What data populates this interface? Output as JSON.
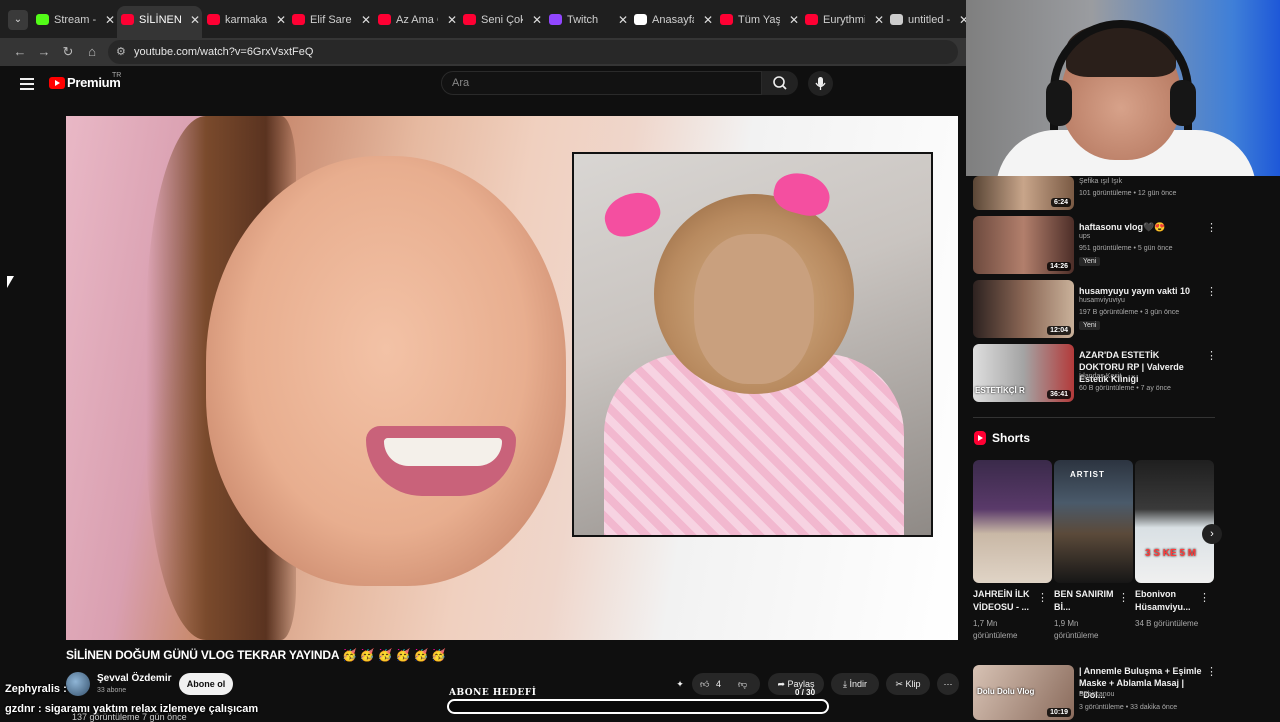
{
  "browser": {
    "tabs": [
      {
        "label": "Stream - K",
        "color": "#53fc18"
      },
      {
        "label": "SİLİNEN D",
        "color": "#ff0033",
        "active": true
      },
      {
        "label": "karmakarış",
        "color": "#ff0033"
      },
      {
        "label": "Elif Sare Al",
        "color": "#ff0033"
      },
      {
        "label": "Az Ama Öz",
        "color": "#ff0033"
      },
      {
        "label": "Seni Çok S",
        "color": "#ff0033"
      },
      {
        "label": "Twitch",
        "color": "#9146ff"
      },
      {
        "label": "Anasayfa /",
        "color": "#ffffff"
      },
      {
        "label": "Tüm Yaş K",
        "color": "#ff0033"
      },
      {
        "label": "Eurythmics",
        "color": "#ff0033"
      },
      {
        "label": "untitled - ",
        "color": "#cccccc"
      }
    ],
    "url": "youtube.com/watch?v=6GrxVsxtFeQ"
  },
  "header": {
    "logo": "Premium",
    "region": "TR",
    "search_placeholder": "Ara"
  },
  "video": {
    "title": "SİLİNEN DOĞUM GÜNÜ VLOG TEKRAR YAYINDA",
    "title_emojis": "🥳 🥳 🥳 🥳 🥳 🥳",
    "channel": "Şevval Özdemir",
    "subscribers": "33 abone",
    "subscribe_label": "Abone ol",
    "likes": "4",
    "share_label": "Paylaş",
    "download_label": "İndir",
    "clip_label": "Klip",
    "views_line": "137 görüntüleme  7 gün önce"
  },
  "sidebar": {
    "recommendations": [
      {
        "title": "",
        "channel": "Şefika ışıl Işık",
        "meta": "101 görüntüleme • 12 gün önce",
        "duration": "6:24",
        "badge": ""
      },
      {
        "title": "haftasonu vlog🖤😍",
        "channel": "ups",
        "meta": "951 görüntüleme • 5 gün önce",
        "duration": "14:26",
        "badge": "Yeni"
      },
      {
        "title": "husamyuyu yayın vakti 10",
        "channel": "husamviyuviyu",
        "meta": "197 B görüntüleme • 3 gün önce",
        "duration": "12:04",
        "badge": "Yeni"
      },
      {
        "title": "AZAR'DA ESTETİK DOKTORU RP | Valverde Estetik Kliniği",
        "channel": "İrlandas Kesit",
        "meta": "60 B görüntüleme • 7 ay önce",
        "duration": "36:41",
        "badge": ""
      }
    ],
    "shorts_heading": "Shorts",
    "shorts": [
      {
        "title": "JAHREİN İLK VİDEOSU - ...",
        "views": "1,7 Mn görüntüleme"
      },
      {
        "title": "BEN SANIRIM Bİ...",
        "views": "1,9 Mn görüntüleme"
      },
      {
        "title": "Ebonivon Hüsamviyu...",
        "views": "34 B görüntüleme"
      }
    ],
    "short_overlay_texts": [
      "ARTIST",
      "3 S KE 5 M"
    ],
    "thumb_overlay_text": "ESTETİKÇİ R",
    "bottom_rec": {
      "title": "| Annemle Buluşma + Eşimle Maske + Ablamla Masaj | \"Dol...",
      "channel": "Bubircanou",
      "meta": "3 görüntüleme • 33 dakika önce",
      "duration": "10:19",
      "thumb_text": "Dolu Dolu Vlog"
    }
  },
  "overlay": {
    "chat": [
      {
        "user": "Zephyralis",
        "message": ""
      },
      {
        "user": "gzdnr",
        "message": "sigaramı yaktım relax izlemeye çalışıcam"
      }
    ],
    "goal_label": "ABONE HEDEFİ",
    "goal_current": "0",
    "goal_target": "30",
    "goal_progress": 0.0
  },
  "colors": {
    "background": "#0f0f0f",
    "accent": "#ff0033",
    "chip": "#272727"
  }
}
